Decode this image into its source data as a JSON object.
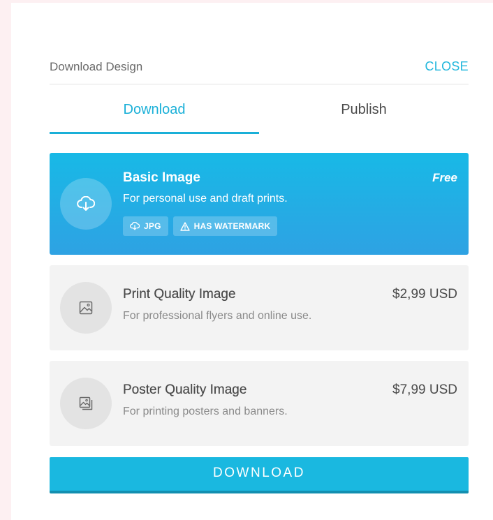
{
  "header": {
    "title": "Download Design",
    "close_label": "CLOSE"
  },
  "tabs": [
    {
      "label": "Download",
      "active": true
    },
    {
      "label": "Publish",
      "active": false
    }
  ],
  "options": [
    {
      "title": "Basic Image",
      "description": "For personal use and draft prints.",
      "price": "Free",
      "icon": "cloud-download-icon",
      "selected": true,
      "badges": [
        {
          "icon": "cloud-download-icon",
          "label": "JPG"
        },
        {
          "icon": "warning-icon",
          "label": "HAS WATERMARK"
        }
      ]
    },
    {
      "title": "Print Quality Image",
      "description": "For professional flyers and online use.",
      "price": "$2,99 USD",
      "icon": "image-icon",
      "selected": false
    },
    {
      "title": "Poster Quality Image",
      "description": "For printing posters and banners.",
      "price": "$7,99 USD",
      "icon": "poster-image-icon",
      "selected": false
    }
  ],
  "download_button": {
    "label": "DOWNLOAD"
  },
  "colors": {
    "accent": "#1ab8e0",
    "selected_gradient_top": "#18b9e6",
    "selected_gradient_bottom": "#2ea2e3",
    "card_bg": "#f3f3f3",
    "page_bg": "#fdf0f2"
  }
}
